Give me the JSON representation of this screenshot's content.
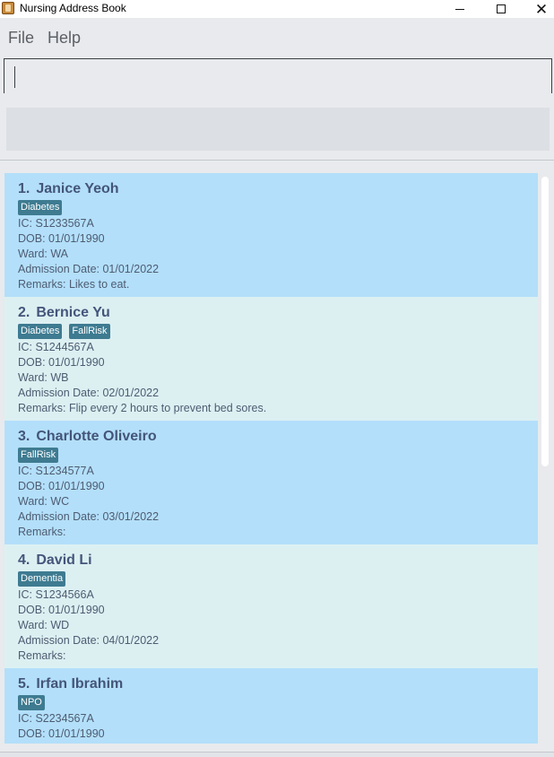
{
  "window": {
    "title": "Nursing Address Book",
    "controls": {
      "minimize": "minimize",
      "maximize": "maximize",
      "close": "✕"
    }
  },
  "menu": {
    "items": [
      {
        "label": "File"
      },
      {
        "label": "Help"
      }
    ]
  },
  "command": {
    "value": "",
    "placeholder": ""
  },
  "result": {
    "text": ""
  },
  "patients": [
    {
      "index": "1.",
      "name": "Janice Yeoh",
      "tags": [
        "Diabetes"
      ],
      "ic": "IC: S1233567A",
      "dob": "DOB: 01/01/1990",
      "ward": "Ward: WA",
      "admission": "Admission Date: 01/01/2022",
      "remarks": "Remarks: Likes to eat."
    },
    {
      "index": "2.",
      "name": "Bernice Yu",
      "tags": [
        "Diabetes",
        "FallRisk"
      ],
      "ic": "IC: S1244567A",
      "dob": "DOB: 01/01/1990",
      "ward": "Ward: WB",
      "admission": "Admission Date: 02/01/2022",
      "remarks": "Remarks: Flip every 2 hours to prevent bed sores."
    },
    {
      "index": "3.",
      "name": "Charlotte Oliveiro",
      "tags": [
        "FallRisk"
      ],
      "ic": "IC: S1234577A",
      "dob": "DOB: 01/01/1990",
      "ward": "Ward: WC",
      "admission": "Admission Date: 03/01/2022",
      "remarks": "Remarks:"
    },
    {
      "index": "4.",
      "name": "David Li",
      "tags": [
        "Dementia"
      ],
      "ic": "IC: S1234566A",
      "dob": "DOB: 01/01/1990",
      "ward": "Ward: WD",
      "admission": "Admission Date: 04/01/2022",
      "remarks": "Remarks:"
    },
    {
      "index": "5.",
      "name": "Irfan Ibrahim",
      "tags": [
        "NPO"
      ],
      "ic": "IC: S2234567A",
      "dob": "DOB: 01/01/1990"
    }
  ],
  "colors": {
    "card_odd": "#b3dffa",
    "card_even": "#dcf0f2",
    "tag_bg": "#3e7b91",
    "title_text": "#44557a",
    "field_text": "#4e5c72"
  },
  "icons": {
    "app": "address-book-icon",
    "minimize": "minimize-icon",
    "maximize": "maximize-icon",
    "close": "close-icon"
  }
}
